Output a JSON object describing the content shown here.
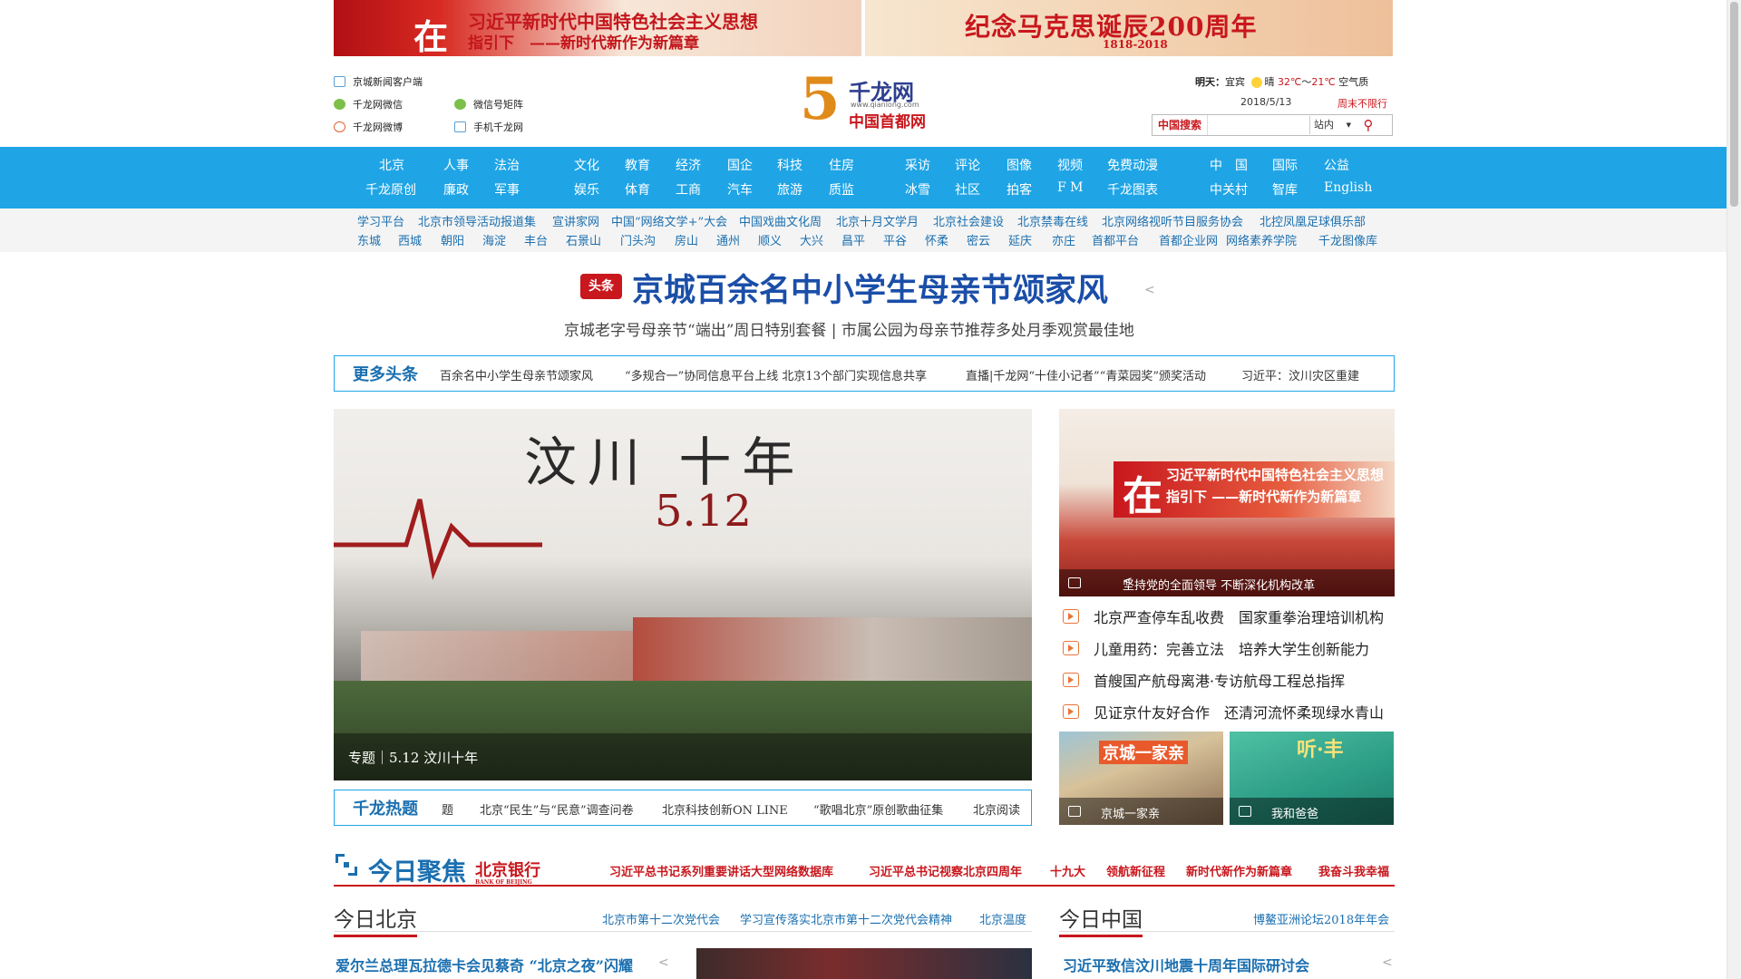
{
  "banners": {
    "left": {
      "seal": "在",
      "line1": "习近平新时代中国特色社会主义思想",
      "line2": "指引下　——新时代新作为新篇章"
    },
    "right": {
      "line1": "纪念马克思诞辰200周年",
      "line2": "1818-2018"
    }
  },
  "header_links": [
    {
      "label": "京城新闻客户端",
      "icon": "phone-icon"
    },
    {
      "label": "千龙网微信",
      "icon": "wechat-icon"
    },
    {
      "label": "微信号矩阵",
      "icon": "wechat-icon"
    },
    {
      "label": "千龙网微博",
      "icon": "weibo-icon"
    },
    {
      "label": "手机千龙网",
      "icon": "mobile-icon"
    }
  ],
  "logo": {
    "glyph": "5",
    "name": "千龙网",
    "url": "www.qianlong.com",
    "caption": "中国首都网"
  },
  "weather": {
    "label": "明天：",
    "condition": "宜宾",
    "sky": "晴",
    "temp_high": "32℃",
    "sep": "～",
    "temp_low": "21℃",
    "air": "空气质"
  },
  "date": "2018/5/13",
  "traffic": "周末不限行",
  "search": {
    "label": "中国搜索",
    "scope": "站内",
    "button": "⚲"
  },
  "nav": [
    [
      "北京",
      "千龙原创"
    ],
    [
      "人事",
      "廉政"
    ],
    [
      "法治",
      "军事"
    ],
    [
      "文化",
      "娱乐"
    ],
    [
      "教育",
      "体育"
    ],
    [
      "经济",
      "工商"
    ],
    [
      "国企",
      "汽车"
    ],
    [
      "科技",
      "旅游"
    ],
    [
      "住房",
      "质监"
    ],
    [
      "采访",
      "冰雪"
    ],
    [
      "评论",
      "社区"
    ],
    [
      "图像",
      "拍客"
    ],
    [
      "视频",
      "F M"
    ],
    [
      "免费动漫",
      "千龙图表"
    ],
    [
      "中　国",
      "中关村"
    ],
    [
      "国际",
      "智库"
    ],
    [
      "公益",
      "English"
    ]
  ],
  "band_row1": [
    "学习平台",
    "北京市领导活动报道集",
    "宣讲家网",
    "中国“网络文学+”大会",
    "中国戏曲文化周",
    "北京十月文学月",
    "北京社会建设",
    "北京禁毒在线",
    "北京网络视听节目服务协会",
    "北控凤凰足球俱乐部"
  ],
  "band_row2": [
    "东城",
    "西城",
    "朝阳",
    "海淀",
    "丰台",
    "石景山",
    "门头沟",
    "房山",
    "通州",
    "顺义",
    "大兴",
    "昌平",
    "平谷",
    "怀柔",
    "密云",
    "延庆",
    "亦庄",
    "首都平台",
    "首都企业网",
    "网络素养学院",
    "千龙图像库"
  ],
  "headline": {
    "tag": "头条",
    "title": "京城百余名中小学生母亲节颂家风",
    "subtitle": "京城老字号母亲节“端出”周日特别套餐 | 市属公园为母亲节推荐多处月季观赏最佳地"
  },
  "more_headlines": {
    "label": "更多头条",
    "items": [
      "百余名中小学生母亲节颂家风",
      "“多规合一”协同信息平台上线 北京13个部门实现信息共享",
      "直播|千龙网“十佳小记者”“青菜园奖”颁奖活动",
      "习近平：汶川灾区重建"
    ]
  },
  "slider": {
    "title_line1": "汶川 十年",
    "title_line2": "5.12",
    "caption": "专题｜5.12 汶川十年",
    "dots": 8,
    "active_dot": 0
  },
  "hot_topics": {
    "label": "千龙热题",
    "items": [
      "题",
      "北京“民生”与“民意”调查问卷",
      "北京科技创新ON LINE",
      "“歌唱北京”原创歌曲征集",
      "北京阅读"
    ]
  },
  "right_feature": {
    "seal": "在",
    "line1": "习近平新时代中国特色社会主义思想",
    "line2": "指引下 ——新时代新作为新篇章",
    "caption": "坚持党的全面领导 不断深化机构改革"
  },
  "right_list": [
    "北京严查停车乱收费　国家重拳治理培训机构",
    "儿童用药：完善立法　培养大学生创新能力",
    "首艘国产航母离港·专访航母工程总指挥",
    "见证京什友好合作　还清河流怀柔现绿水青山"
  ],
  "thumbs": [
    {
      "top_text": "京城一家亲",
      "caption": "京城一家亲"
    },
    {
      "top_text": "听·丰",
      "caption": "我和爸爸"
    }
  ],
  "focus": {
    "title": "今日聚焦",
    "bank": "北京银行",
    "bank_en": "BANK OF BEIJING",
    "links": [
      "习近平总书记系列重要讲话大型网络数据库",
      "习近平总书记视察北京四周年",
      "十九大",
      "领航新征程",
      "新时代新作为新篇章",
      "我奋斗我幸福"
    ]
  },
  "beijing_section": {
    "title": "今日北京",
    "links": [
      "北京市第十二次党代会",
      "学习宣传落实北京市第十二次党代会精神",
      "北京温度"
    ],
    "story": "爱尔兰总理瓦拉德卡会见蔡奇 “北京之夜”闪耀"
  },
  "china_section": {
    "title": "今日中国",
    "links": [
      "博鳌亚洲论坛2018年年会"
    ],
    "story": "习近平致信汶川地震十周年国际研讨会"
  },
  "colors": {
    "nav_blue": "#1fa5e6",
    "brand_red": "#c8171d",
    "link_blue": "#1a6fb0"
  }
}
